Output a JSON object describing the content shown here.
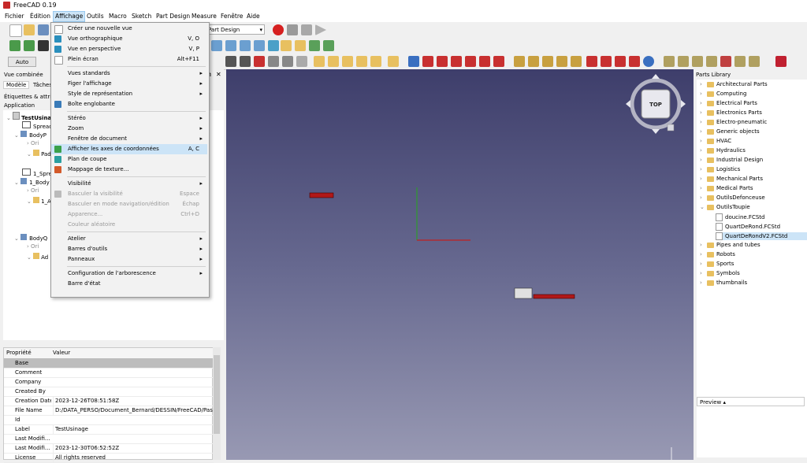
{
  "window": {
    "title": "FreeCAD 0.19"
  },
  "menubar": [
    "Fichier",
    "Édition",
    "Affichage",
    "Outils",
    "Macro",
    "Sketch",
    "Part Design",
    "Measure",
    "Fenêtre",
    "Aide"
  ],
  "workbench": "Part Design",
  "toolbar": {
    "auto_label": "Auto"
  },
  "left": {
    "header": "Vue combinée",
    "tabs": [
      "Modèle",
      "Tâches"
    ],
    "labels_header": "Étiquettes & attrib",
    "tree_root": "Application",
    "tree": [
      "TestUsinage",
      "Spread",
      "BodyP",
      "Ori",
      "Pad",
      "1_Spre",
      "1_Body",
      "Ori",
      "1_A",
      "BodyQ",
      "Ori",
      "Ad"
    ]
  },
  "properties": {
    "col_name": "Propriété",
    "col_value": "Valeur",
    "group": "Base",
    "rows": [
      {
        "name": "Comment",
        "value": ""
      },
      {
        "name": "Company",
        "value": ""
      },
      {
        "name": "Created By",
        "value": ""
      },
      {
        "name": "Creation Date",
        "value": "2023-12-26T08:51:58Z"
      },
      {
        "name": "File Name",
        "value": "D:/DATA_PERSO/Document_Bernard/DESSIN/FreeCAD/PasAp..."
      },
      {
        "name": "Id",
        "value": ""
      },
      {
        "name": "Label",
        "value": "TestUsinage"
      },
      {
        "name": "Last Modifi...",
        "value": ""
      },
      {
        "name": "Last Modifi...",
        "value": "2023-12-30T06:52:52Z"
      },
      {
        "name": "License",
        "value": "All rights reserved"
      }
    ]
  },
  "viewcube": {
    "face": "TOP"
  },
  "parts": {
    "header": "Parts Library",
    "items": [
      {
        "label": "Architectural Parts",
        "kind": "folder",
        "exp": "›"
      },
      {
        "label": "Computing",
        "kind": "folder",
        "exp": "›"
      },
      {
        "label": "Electrical Parts",
        "kind": "folder",
        "exp": "›"
      },
      {
        "label": "Electronics Parts",
        "kind": "folder",
        "exp": "›"
      },
      {
        "label": "Electro-pneumatic",
        "kind": "folder",
        "exp": "›"
      },
      {
        "label": "Generic objects",
        "kind": "folder",
        "exp": "›"
      },
      {
        "label": "HVAC",
        "kind": "folder",
        "exp": "›"
      },
      {
        "label": "Hydraulics",
        "kind": "folder",
        "exp": "›"
      },
      {
        "label": "Industrial Design",
        "kind": "folder",
        "exp": "›"
      },
      {
        "label": "Logistics",
        "kind": "folder",
        "exp": "›"
      },
      {
        "label": "Mechanical Parts",
        "kind": "folder",
        "exp": "›"
      },
      {
        "label": "Medical Parts",
        "kind": "folder",
        "exp": "›"
      },
      {
        "label": "OutilsDefonceuse",
        "kind": "folder",
        "exp": "›"
      },
      {
        "label": "OutilsToupie",
        "kind": "folder",
        "exp": "⌄"
      },
      {
        "label": "doucine.FCStd",
        "kind": "file",
        "exp": ""
      },
      {
        "label": "QuartDeRond.FCStd",
        "kind": "file",
        "exp": ""
      },
      {
        "label": "QuartDeRondV2.FCStd",
        "kind": "file",
        "exp": ""
      },
      {
        "label": "Pipes and tubes",
        "kind": "folder",
        "exp": "›"
      },
      {
        "label": "Robots",
        "kind": "folder",
        "exp": "›"
      },
      {
        "label": "Sports",
        "kind": "folder",
        "exp": "›"
      },
      {
        "label": "Symbols",
        "kind": "folder",
        "exp": "›"
      },
      {
        "label": "thumbnails",
        "kind": "folder",
        "exp": "›"
      }
    ],
    "preview": "Preview ▴"
  },
  "menu": {
    "items": [
      {
        "label": "Créer une nouvelle vue",
        "sc": "",
        "arrow": false,
        "disabled": false,
        "icon": "new-view-icon",
        "color": "#ffffff"
      },
      {
        "label": "Vue orthographique",
        "sc": "V, O",
        "arrow": false,
        "disabled": false,
        "icon": "ortho-icon",
        "color": "#2a8fbd"
      },
      {
        "label": "Vue en perspective",
        "sc": "V, P",
        "arrow": false,
        "disabled": false,
        "icon": "perspective-icon",
        "color": "#2a8fbd"
      },
      {
        "label": "Plein écran",
        "sc": "Alt+F11",
        "arrow": false,
        "disabled": false,
        "icon": "fullscreen-icon",
        "color": "#ffffff"
      },
      {
        "sep": true
      },
      {
        "label": "Vues standards",
        "sc": "",
        "arrow": true,
        "disabled": false,
        "icon": "",
        "color": ""
      },
      {
        "label": "Figer l'affichage",
        "sc": "",
        "arrow": true,
        "disabled": false,
        "icon": "",
        "color": ""
      },
      {
        "label": "Style de représentation",
        "sc": "",
        "arrow": true,
        "disabled": false,
        "icon": "",
        "color": ""
      },
      {
        "label": "Boîte englobante",
        "sc": "",
        "arrow": false,
        "disabled": false,
        "icon": "bounding-box-icon",
        "color": "#3a7bb8"
      },
      {
        "sep": true
      },
      {
        "label": "Stéréo",
        "sc": "",
        "arrow": true,
        "disabled": false,
        "icon": "",
        "color": ""
      },
      {
        "label": "Zoom",
        "sc": "",
        "arrow": true,
        "disabled": false,
        "icon": "",
        "color": ""
      },
      {
        "label": "Fenêtre de document",
        "sc": "",
        "arrow": true,
        "disabled": false,
        "icon": "",
        "color": ""
      },
      {
        "label": "Afficher les axes de coordonnées",
        "sc": "A, C",
        "arrow": false,
        "disabled": false,
        "icon": "axis-cross-icon",
        "color": "#3aa14a",
        "hl": true
      },
      {
        "label": "Plan de coupe",
        "sc": "",
        "arrow": false,
        "disabled": false,
        "icon": "clipping-plane-icon",
        "color": "#2a9fa0"
      },
      {
        "label": "Mappage de texture...",
        "sc": "",
        "arrow": false,
        "disabled": false,
        "icon": "texture-icon",
        "color": "#d35a2a"
      },
      {
        "sep": true
      },
      {
        "label": "Visibilité",
        "sc": "",
        "arrow": true,
        "disabled": false,
        "icon": "",
        "color": ""
      },
      {
        "label": "Basculer la visibilité",
        "sc": "Espace",
        "arrow": false,
        "disabled": true,
        "icon": "eye-icon",
        "color": "#bbbbbb"
      },
      {
        "label": "Basculer en mode navigation/édition",
        "sc": "Échap",
        "arrow": false,
        "disabled": true,
        "icon": "",
        "color": ""
      },
      {
        "label": "Apparence...",
        "sc": "Ctrl+D",
        "arrow": false,
        "disabled": true,
        "icon": "",
        "color": ""
      },
      {
        "label": "Couleur aléatoire",
        "sc": "",
        "arrow": false,
        "disabled": true,
        "icon": "",
        "color": ""
      },
      {
        "sep": true
      },
      {
        "label": "Atelier",
        "sc": "",
        "arrow": true,
        "disabled": false,
        "icon": "",
        "color": ""
      },
      {
        "label": "Barres d'outils",
        "sc": "",
        "arrow": true,
        "disabled": false,
        "icon": "",
        "color": ""
      },
      {
        "label": "Panneaux",
        "sc": "",
        "arrow": true,
        "disabled": false,
        "icon": "",
        "color": ""
      },
      {
        "sep": true
      },
      {
        "label": "Configuration de l'arborescence",
        "sc": "",
        "arrow": true,
        "disabled": false,
        "icon": "",
        "color": ""
      },
      {
        "label": "Barre d'état",
        "sc": "",
        "arrow": false,
        "disabled": false,
        "icon": "",
        "color": ""
      }
    ]
  }
}
